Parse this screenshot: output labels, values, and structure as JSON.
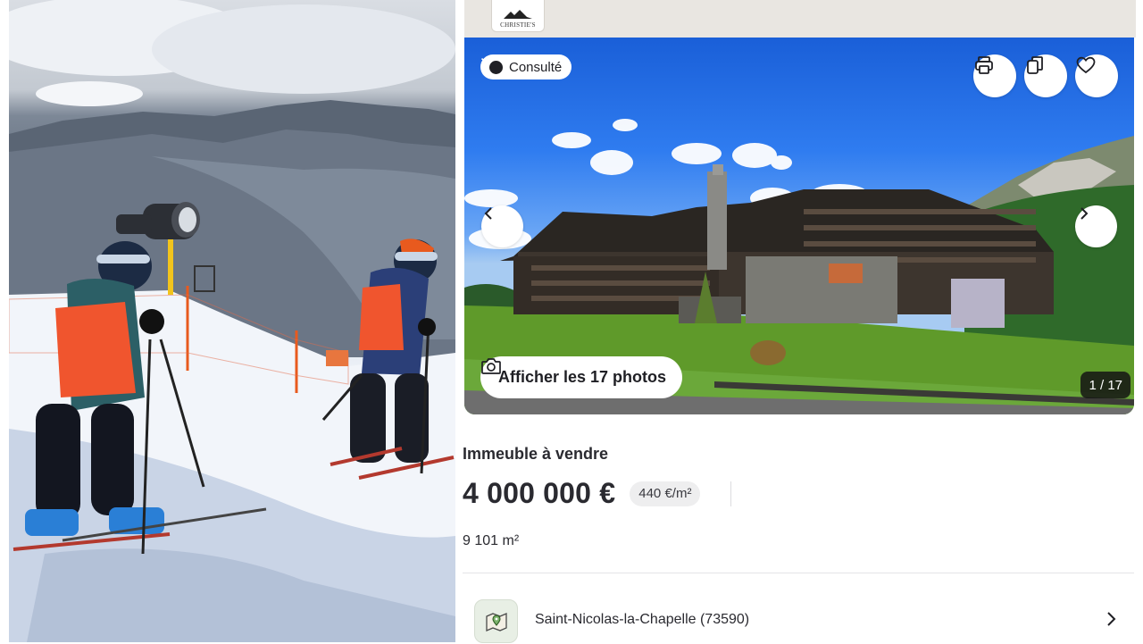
{
  "listing": {
    "agency": {
      "logo_text": "CHRISTIE'S"
    },
    "gallery": {
      "viewed_badge": "Consulté",
      "show_photos_label": "Afficher les 17 photos",
      "counter": "1 / 17",
      "icons": [
        "print-icon",
        "copy-icon",
        "heart-icon",
        "chevron-left-icon",
        "chevron-right-icon",
        "camera-icon"
      ]
    },
    "property_type": "Immeuble à vendre",
    "price": "4 000 000 €",
    "price_per_m2": "440 €/m²",
    "surface": "9 101 m²",
    "location": "Saint-Nicolas-la-Chapelle (73590)"
  },
  "colors": {
    "sky": "#2f7cf0",
    "grass": "#5f9a2a",
    "text": "#2a2a30"
  }
}
